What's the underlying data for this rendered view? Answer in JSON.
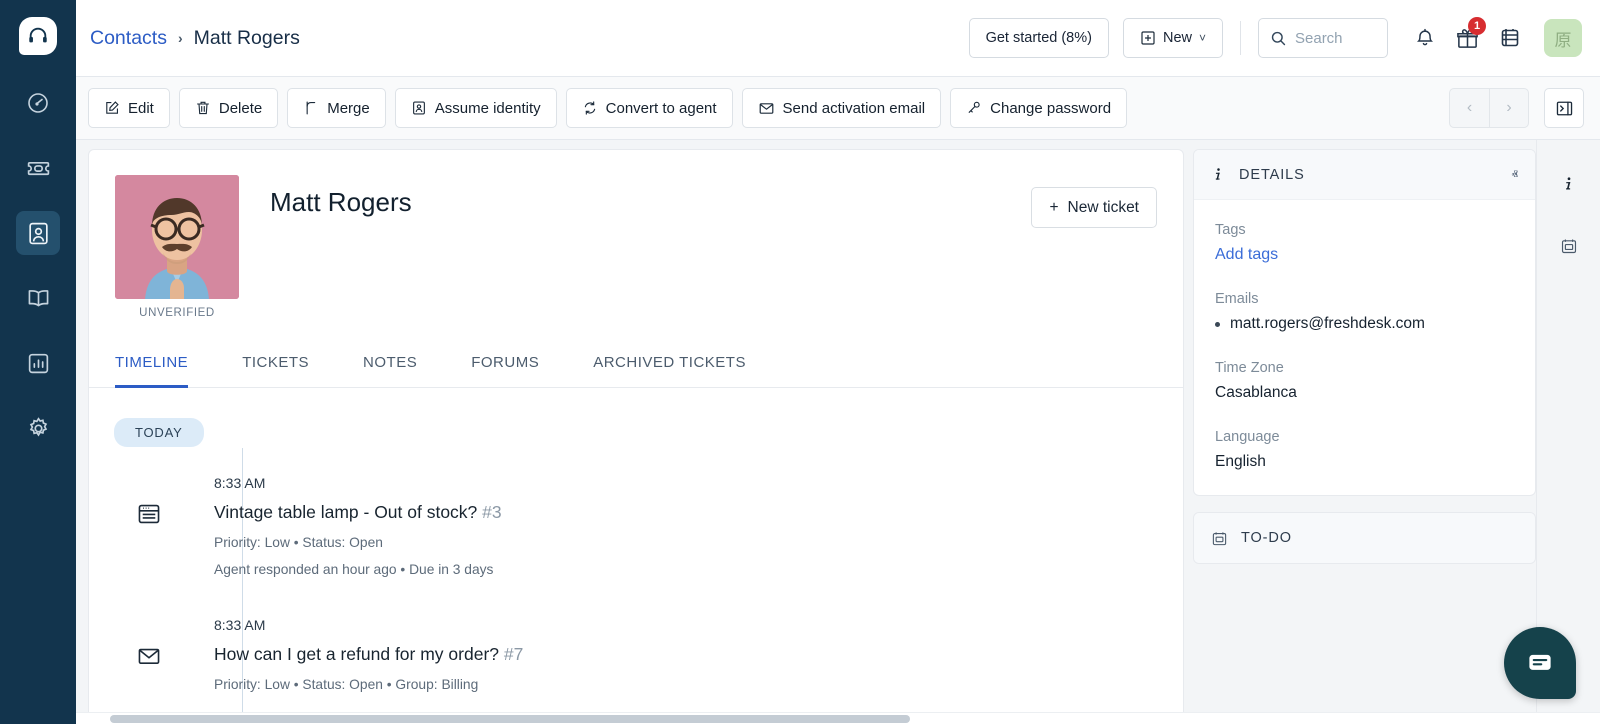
{
  "theme": {
    "rail_bg": "#12344d",
    "accent": "#2c5cc5",
    "link": "#3b6dd8",
    "badge": "#d72d30",
    "avatar_bg": "#c9e5bd",
    "chat_bg": "#15424b",
    "today_pill_bg": "#dcebf8"
  },
  "sidebar": {
    "logo_name": "freshdesk-headset-logo",
    "items": [
      {
        "name": "dashboard-icon",
        "label": "Dashboard",
        "active": false
      },
      {
        "name": "tickets-icon",
        "label": "Tickets",
        "active": false
      },
      {
        "name": "contacts-icon",
        "label": "Contacts",
        "active": true
      },
      {
        "name": "solutions-book-icon",
        "label": "Solutions",
        "active": false
      },
      {
        "name": "analytics-icon",
        "label": "Analytics",
        "active": false
      },
      {
        "name": "settings-gear-icon",
        "label": "Admin",
        "active": false
      }
    ]
  },
  "header": {
    "breadcrumb_root": "Contacts",
    "breadcrumb_separator": "›",
    "breadcrumb_current": "Matt Rogers",
    "get_started_label": "Get started (8%)",
    "new_label": "New",
    "new_caret": "˅",
    "search_placeholder": "Search",
    "notification_badge": "",
    "gift_badge": "1",
    "avatar_initial": "原"
  },
  "toolbar": {
    "buttons": [
      {
        "icon": "edit-pencil-icon",
        "label": "Edit"
      },
      {
        "icon": "trash-icon",
        "label": "Delete"
      },
      {
        "icon": "merge-icon",
        "label": "Merge"
      },
      {
        "icon": "id-card-icon",
        "label": "Assume identity"
      },
      {
        "icon": "convert-icon",
        "label": "Convert to agent"
      },
      {
        "icon": "envelope-icon",
        "label": "Send activation email"
      },
      {
        "icon": "key-icon",
        "label": "Change password"
      }
    ],
    "prev_label": "‹",
    "next_label": "›",
    "panel_toggle_name": "toggle-side-panel"
  },
  "contact": {
    "name": "Matt Rogers",
    "verification_status": "UNVERIFIED",
    "new_ticket_label": "New ticket",
    "new_ticket_plus": "+",
    "tabs": [
      {
        "label": "TIMELINE",
        "active": true
      },
      {
        "label": "TICKETS",
        "active": false
      },
      {
        "label": "NOTES",
        "active": false
      },
      {
        "label": "FORUMS",
        "active": false
      },
      {
        "label": "ARCHIVED TICKETS",
        "active": false
      }
    ]
  },
  "timeline": {
    "group_label": "TODAY",
    "entries": [
      {
        "icon": "ticket-note-icon",
        "time": "8:33 AM",
        "title": "Vintage table lamp - Out of stock?",
        "ticket_number": "#3",
        "meta1": "Priority: Low  •  Status: Open",
        "meta2": "Agent responded an hour ago  •  Due in 3 days"
      },
      {
        "icon": "envelope-icon",
        "time": "8:33 AM",
        "title": "How can I get a refund for my order?",
        "ticket_number": "#7",
        "meta1": "Priority: Low  •  Status: Open  •  Group: Billing",
        "meta2": ""
      }
    ]
  },
  "details_panel": {
    "icon": "info-icon",
    "title": "DETAILS",
    "collapse_caret": "ⱏ",
    "fields": [
      {
        "label": "Tags",
        "type": "link",
        "value": "Add tags"
      },
      {
        "label": "Emails",
        "type": "list",
        "value": "matt.rogers@freshdesk.com"
      },
      {
        "label": "Time Zone",
        "type": "text",
        "value": "Casablanca"
      },
      {
        "label": "Language",
        "type": "text",
        "value": "English"
      }
    ]
  },
  "todo_panel": {
    "icon": "todo-calendar-icon",
    "title": "TO-DO",
    "expand_caret": "ⱟ"
  },
  "far_rail": {
    "items": [
      {
        "name": "info-icon",
        "label": "Details"
      },
      {
        "name": "todo-calendar-icon",
        "label": "To-do"
      }
    ]
  },
  "chat": {
    "name": "chat-widget-button",
    "label": "Chat"
  }
}
